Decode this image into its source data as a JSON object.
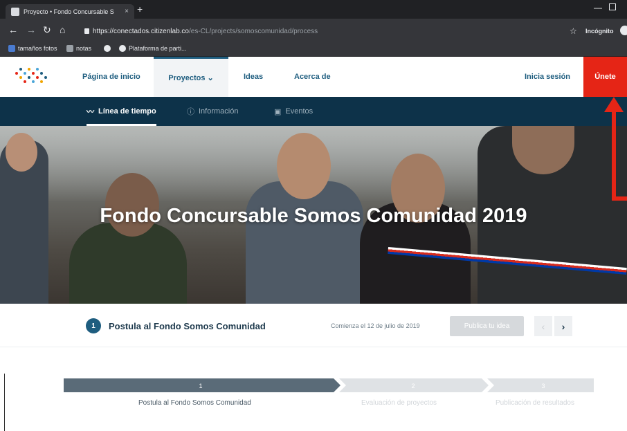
{
  "browser": {
    "tab_title": "Proyecto • Fondo Concursable S",
    "tab_close": "×",
    "new_tab": "+",
    "url_host": "https://conectados.citizenlab.co",
    "url_path": "/es-CL/projects/somoscomunidad/process",
    "incognito_label": "Incógnito",
    "bookmarks": [
      "tamaños fotos",
      "notas",
      "Plataforma de parti..."
    ]
  },
  "header": {
    "nav": [
      "Página de inicio",
      "Proyectos ⌄",
      "Ideas",
      "Acerca de"
    ],
    "signin": "Inicia sesión",
    "join": "Únete"
  },
  "subnav": {
    "items": [
      "Línea de tiempo",
      "Información",
      "Eventos"
    ]
  },
  "hero": {
    "title": "Fondo Concursable Somos Comunidad 2019"
  },
  "phase": {
    "number": "1",
    "title": "Postula al Fondo Somos Comunidad",
    "start": "Comienza el 12 de julio de 2019",
    "publish_button": "Publica tu idea",
    "prev": "‹",
    "next": "›"
  },
  "timeline": {
    "steps": [
      {
        "number": "1",
        "label": "Postula al Fondo Somos Comunidad",
        "active": true
      },
      {
        "number": "2",
        "label": "Evaluación de proyectos",
        "active": false
      },
      {
        "number": "3",
        "label": "Publicación de resultados",
        "active": false
      }
    ]
  },
  "colors": {
    "primary": "#1e5d7f",
    "subnav_bg": "#0d3249",
    "join_red": "#e52516",
    "timeline_active": "#5a6b78",
    "timeline_inactive": "#dfe2e5"
  }
}
